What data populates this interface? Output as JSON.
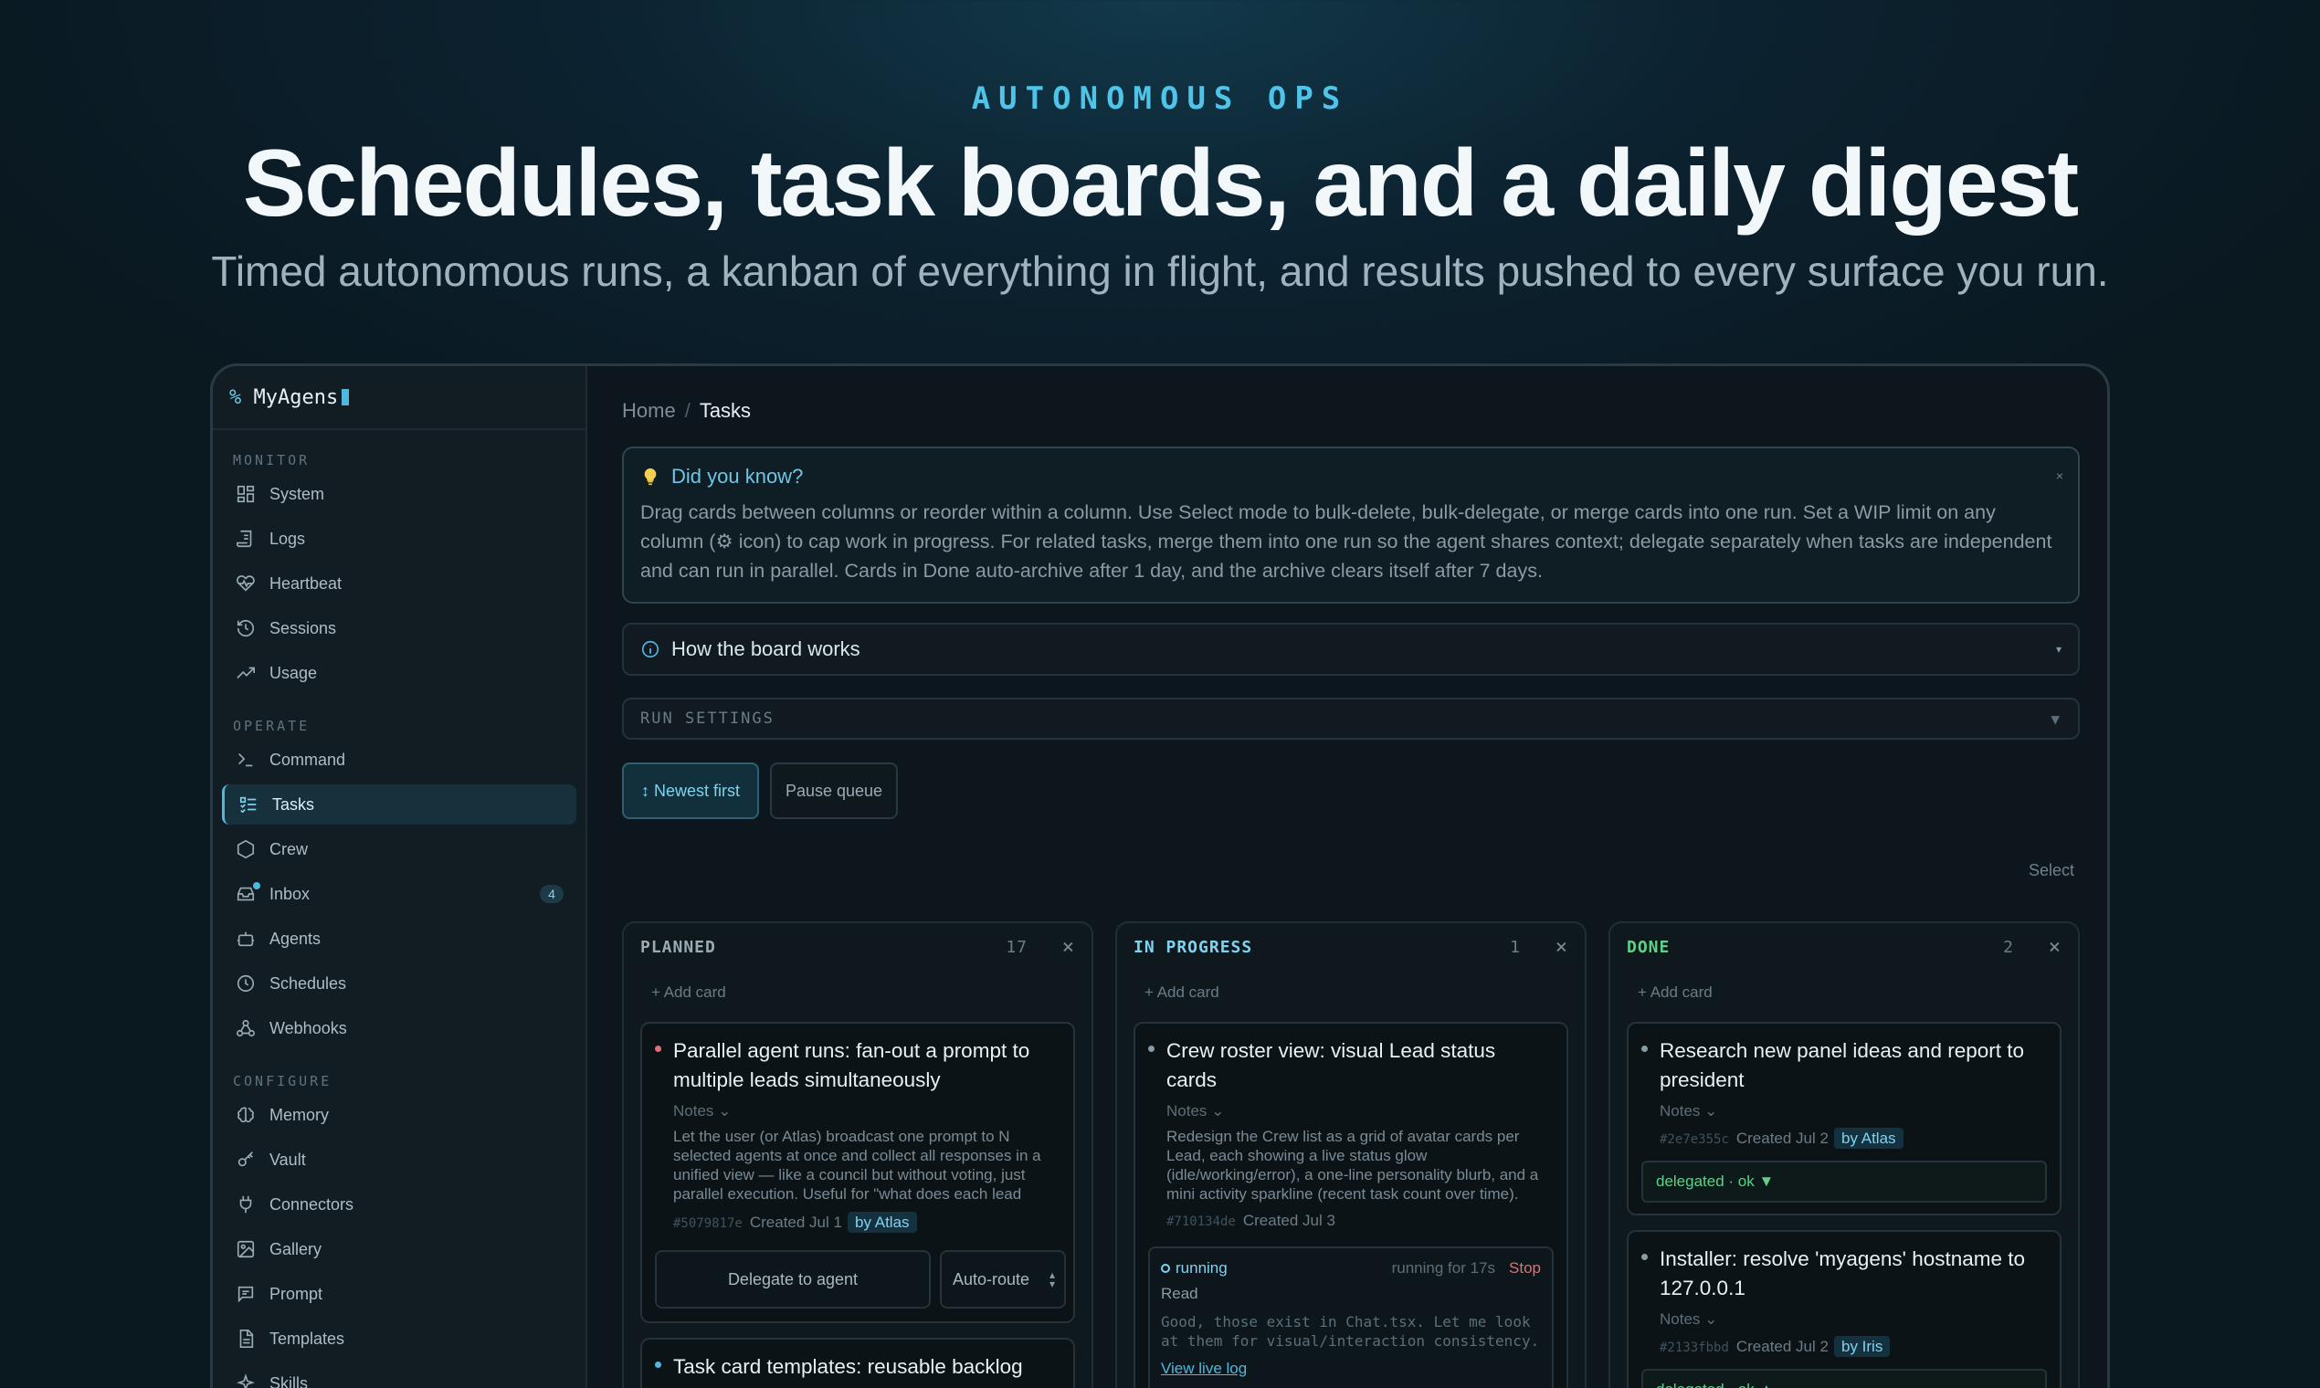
{
  "hero": {
    "eyebrow": "AUTONOMOUS OPS",
    "headline": "Schedules, task boards, and a daily digest",
    "subhead": "Timed autonomous runs, a kanban of everything in flight, and results pushed to every surface you run."
  },
  "app": {
    "brand_prefix": "%",
    "brand_name": "MyAgens"
  },
  "sidebar": {
    "sections": [
      {
        "label": "MONITOR",
        "items": [
          {
            "label": "System",
            "icon": "grid-icon"
          },
          {
            "label": "Logs",
            "icon": "scroll-icon"
          },
          {
            "label": "Heartbeat",
            "icon": "heart-pulse-icon"
          },
          {
            "label": "Sessions",
            "icon": "history-icon"
          },
          {
            "label": "Usage",
            "icon": "trend-icon"
          }
        ]
      },
      {
        "label": "OPERATE",
        "items": [
          {
            "label": "Command",
            "icon": "terminal-icon"
          },
          {
            "label": "Tasks",
            "icon": "checklist-icon",
            "active": true
          },
          {
            "label": "Crew",
            "icon": "hexagon-icon"
          },
          {
            "label": "Inbox",
            "icon": "inbox-icon",
            "badge": "4"
          },
          {
            "label": "Agents",
            "icon": "bot-icon"
          },
          {
            "label": "Schedules",
            "icon": "clock-icon"
          },
          {
            "label": "Webhooks",
            "icon": "webhook-icon"
          }
        ]
      },
      {
        "label": "CONFIGURE",
        "items": [
          {
            "label": "Memory",
            "icon": "brain-icon"
          },
          {
            "label": "Vault",
            "icon": "key-icon"
          },
          {
            "label": "Connectors",
            "icon": "plug-icon"
          },
          {
            "label": "Gallery",
            "icon": "image-icon"
          },
          {
            "label": "Prompt",
            "icon": "message-icon"
          },
          {
            "label": "Templates",
            "icon": "file-icon"
          },
          {
            "label": "Skills",
            "icon": "sparkle-icon"
          }
        ]
      }
    ]
  },
  "breadcrumb": {
    "home": "Home",
    "sep": "/",
    "current": "Tasks"
  },
  "tip": {
    "title": "Did you know?",
    "close": "×",
    "body": "Drag cards between columns or reorder within a column. Use Select mode to bulk-delete, bulk-delegate, or merge cards into one run. Set a WIP limit on any column (⚙ icon) to cap work in progress. For related tasks, merge them into one run so the agent shares context; delegate separately when tasks are independent and can run in parallel. Cards in Done auto-archive after 1 day, and the archive clears itself after 7 days."
  },
  "how_board": {
    "label": "How the board works",
    "caret": "▾"
  },
  "run_settings": {
    "label": "RUN SETTINGS",
    "caret": "▼"
  },
  "toolbar": {
    "newest": "↕ Newest first",
    "pause": "Pause queue",
    "select": "Select"
  },
  "columns": [
    {
      "title": "PLANNED",
      "count": "17",
      "close": "×",
      "add": "+ Add card",
      "cards": [
        {
          "title": "Parallel agent runs: fan-out a prompt to multiple leads simultaneously",
          "notes": "Notes ⌄",
          "desc": "Let the user (or Atlas) broadcast one prompt to N selected agents at once and collect all responses in a unified view — like a council but without voting, just parallel execution. Useful for \"what does each lead think about X\" queries.",
          "hash": "#5079817e",
          "created": "Created Jul 1",
          "by": "by Atlas",
          "delegate": "Delegate to agent",
          "route": "Auto-route"
        },
        {
          "title": "Task card templates: reusable backlog card presets with pre-filled notes"
        }
      ]
    },
    {
      "title": "IN PROGRESS",
      "count": "1",
      "close": "×",
      "add": "+ Add card",
      "cards": [
        {
          "title": "Crew roster view: visual Lead status cards",
          "notes": "Notes ⌄",
          "desc": "Redesign the Crew list as a grid of avatar cards per Lead, each showing a live status glow (idle/working/error), a one-line personality blurb, and a mini activity sparkline (recent task count over time).",
          "hash": "#710134de",
          "created": "Created Jul 3",
          "run": {
            "status": "running",
            "timer": "running for 17s",
            "stop": "Stop",
            "tool": "Read",
            "log": "Good, those exist in Chat.tsx. Let me look at them for visual/interaction consistency.",
            "link": "View live log"
          }
        }
      ]
    },
    {
      "title": "DONE",
      "count": "2",
      "close": "×",
      "add": "+ Add card",
      "cards": [
        {
          "title": "Research new panel ideas and report to president",
          "notes": "Notes ⌄",
          "hash": "#2e7e355c",
          "created": "Created Jul 2",
          "by": "by Atlas",
          "delegated": "delegated · ok ▼"
        },
        {
          "title": "Installer: resolve 'myagens' hostname to 127.0.0.1",
          "notes": "Notes ⌄",
          "hash": "#2133fbbd",
          "created": "Created Jul 2",
          "by": "by Iris",
          "delegated": "delegated · ok ▲"
        }
      ]
    }
  ],
  "colors": {
    "accent": "#4fb8e0",
    "dot_red": "#e36f6f",
    "dot_blue": "#4fb8e0",
    "dot_grey": "#8a9ba4",
    "ok_green": "#5fd08a"
  }
}
